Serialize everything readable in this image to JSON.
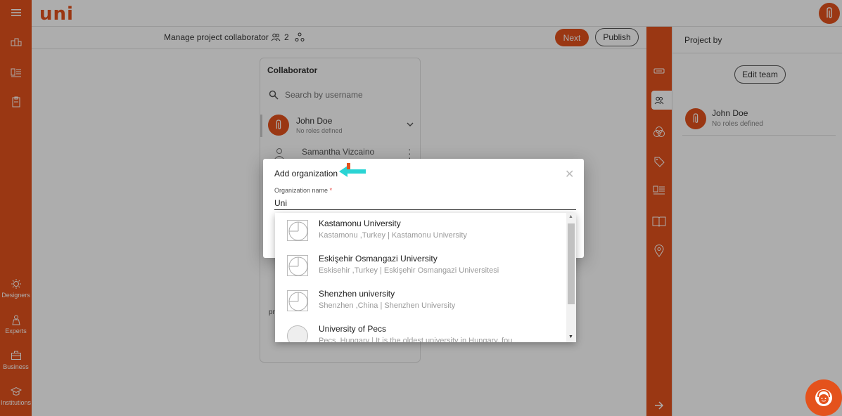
{
  "app": {
    "logo": "uni"
  },
  "left_sidebar": {
    "items": [
      {
        "icon": "home-group-icon"
      },
      {
        "icon": "list-icon"
      },
      {
        "icon": "clipboard-icon"
      }
    ],
    "bottom_items": [
      {
        "label": "Designers",
        "icon": "sun-design-icon"
      },
      {
        "label": "Experts",
        "icon": "person-icon"
      },
      {
        "label": "Business",
        "icon": "briefcase-icon"
      },
      {
        "label": "Institutions",
        "icon": "graduation-icon"
      }
    ]
  },
  "subheader": {
    "title": "Manage project collaborator",
    "collaborator_count": "2",
    "next_label": "Next",
    "publish_label": "Publish"
  },
  "collaborator_panel": {
    "title": "Collaborator",
    "search_placeholder": "Search by username",
    "members": [
      {
        "name": "John Doe",
        "role": "No roles defined"
      },
      {
        "name": "Samantha Vizcaino",
        "role": ""
      }
    ],
    "footer_text": "pr"
  },
  "modal": {
    "title": "Add organization",
    "field_label": "Organization name",
    "required_mark": "*",
    "field_value": "Uni",
    "close_symbol": "✕"
  },
  "dropdown": {
    "items": [
      {
        "name": "Kastamonu University",
        "sub": "Kastamonu ,Turkey | Kastamonu University"
      },
      {
        "name": "Eskişehir Osmangazi University",
        "sub": "Eskisehir ,Turkey | Eskişehir Osmangazi Universitesi"
      },
      {
        "name": "Shenzhen university",
        "sub": "Shenzhen ,China | Shenzhen University"
      },
      {
        "name": "University of Pecs",
        "sub": "Pecs, Hungary | It is the oldest university in Hungary, fou..."
      }
    ]
  },
  "project_panel": {
    "title": "Project by",
    "edit_team_label": "Edit team",
    "member": {
      "name": "John Doe",
      "role": "No roles defined"
    }
  },
  "colors": {
    "brand": "#e4521c",
    "annotation_arrow": "#2ad4d4"
  }
}
